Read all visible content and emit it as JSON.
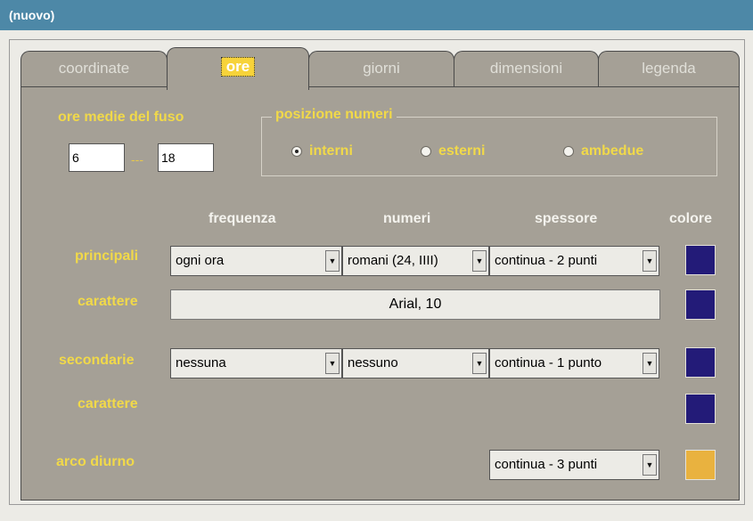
{
  "window": {
    "title": "(nuovo)"
  },
  "tabs": [
    {
      "label": "coordinate",
      "active": false
    },
    {
      "label": "ore",
      "active": true
    },
    {
      "label": "giorni",
      "active": false
    },
    {
      "label": "dimensioni",
      "active": false
    },
    {
      "label": "legenda",
      "active": false
    }
  ],
  "ore_medie": {
    "label": "ore medie del fuso",
    "from": "6",
    "separator": "---",
    "to": "18"
  },
  "posizione_numeri": {
    "title": "posizione numeri",
    "options": [
      {
        "label": "interni",
        "checked": true
      },
      {
        "label": "esterni",
        "checked": false
      },
      {
        "label": "ambedue",
        "checked": false
      }
    ]
  },
  "columns": {
    "frequenza": "frequenza",
    "numeri": "numeri",
    "spessore": "spessore",
    "colore": "colore"
  },
  "principali": {
    "label": "principali",
    "frequenza": "ogni ora",
    "numeri": "romani (24, IIII)",
    "spessore": "continua - 2 punti",
    "colore": "#231b78"
  },
  "carattere_principali": {
    "label": "carattere",
    "font": "Arial, 10",
    "colore": "#231b78"
  },
  "secondarie": {
    "label": "secondarie",
    "frequenza": "nessuna",
    "numeri": "nessuno",
    "spessore": "continua - 1 punto",
    "colore": "#231b78"
  },
  "carattere_secondarie": {
    "label": "carattere",
    "colore": "#231b78"
  },
  "arco_diurno": {
    "label": "arco diurno",
    "spessore": "continua - 3 punti",
    "colore": "#e9b23f"
  },
  "icons": {
    "dropdown": "chevron-down-icon",
    "radio": "radio-icon"
  }
}
